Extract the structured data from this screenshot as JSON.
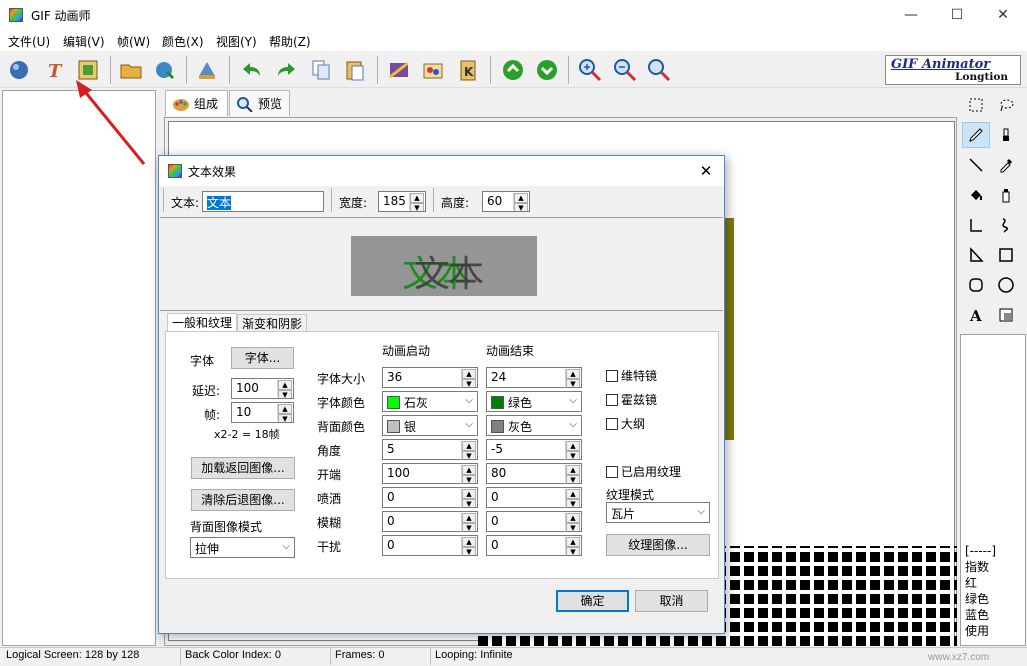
{
  "app": {
    "title": "GIF 动画师"
  },
  "window_controls": {
    "minimize": "—",
    "maximize": "☐",
    "close": "✕"
  },
  "menu": [
    "文件(U)",
    "编辑(V)",
    "帧(W)",
    "颜色(X)",
    "视图(Y)",
    "帮助(Z)"
  ],
  "toolbar": {
    "icons": [
      "globe-icon",
      "text-effect-icon",
      "image-frame-icon",
      "open-folder-icon",
      "load-icon",
      "wizard-icon",
      "undo-icon",
      "redo-icon",
      "copy-icon",
      "paste-icon",
      "frame-effect-icon",
      "stamp-icon",
      "clipboard-icon",
      "arrow-up-icon",
      "arrow-down-icon",
      "zoom-in-icon",
      "zoom-out-icon",
      "zoom-fit-icon"
    ]
  },
  "brand": {
    "title": "GIF Animator",
    "subtitle": "Longtion"
  },
  "main_tabs": [
    {
      "label": "组成"
    },
    {
      "label": "预览"
    }
  ],
  "right_tools": [
    "rect-select-icon",
    "lasso-icon",
    "pen-icon",
    "brush-icon",
    "line-icon",
    "eyedropper-icon",
    "fill-icon",
    "spray-icon",
    "polyline-icon",
    "curve-icon",
    "polygon-icon",
    "rectangle-icon",
    "rounded-rect-icon",
    "ellipse-icon",
    "text-tool-icon",
    "stamp-tool-icon"
  ],
  "info_panel": {
    "lines": [
      "[-----]",
      "指数",
      "红",
      "绿色",
      "蓝色",
      "使用"
    ]
  },
  "status": {
    "logical_screen": "Logical Screen: 128 by 128",
    "back_color": "Back Color Index: 0",
    "frames": "Frames: 0",
    "looping": "Looping: Infinite"
  },
  "watermark": "www.xz7.com",
  "dialog": {
    "title": "文本效果",
    "text_label": "文本:",
    "text_value": "文本",
    "width_label": "宽度:",
    "width_value": "185",
    "height_label": "高度:",
    "height_value": "60",
    "preview_text": "文本",
    "tabs": [
      "一般和纹理",
      "渐变和阴影"
    ],
    "font_label": "字体",
    "font_button": "字体...",
    "delay_label": "延迟:",
    "delay_value": "100",
    "frames_label": "帧:",
    "frames_value": "10",
    "frames_note": "x2-2 = 18帧",
    "load_back_button": "加载返回图像...",
    "clear_back_button": "清除后退图像...",
    "back_mode_label": "背面图像模式",
    "back_mode_value": "拉伸",
    "col_start": "动画启动",
    "col_end": "动画结束",
    "rows": [
      {
        "label": "字体大小",
        "start": "36",
        "end": "24",
        "kind": "spin"
      },
      {
        "label": "字体颜色",
        "start": "石灰",
        "end": "绿色",
        "kind": "color",
        "start_color": "#00ff00",
        "end_color": "#008000"
      },
      {
        "label": "背面颜色",
        "start": "银",
        "end": "灰色",
        "kind": "color",
        "start_color": "#c0c0c0",
        "end_color": "#808080"
      },
      {
        "label": "角度",
        "start": "5",
        "end": "-5",
        "kind": "spin"
      },
      {
        "label": "开端",
        "start": "100",
        "end": "80",
        "kind": "spin"
      },
      {
        "label": "喷洒",
        "start": "0",
        "end": "0",
        "kind": "spin"
      },
      {
        "label": "模糊",
        "start": "0",
        "end": "0",
        "kind": "spin"
      },
      {
        "label": "干扰",
        "start": "0",
        "end": "0",
        "kind": "spin"
      }
    ],
    "checkboxes": [
      "维特镜",
      "霍兹镜",
      "大纲"
    ],
    "texture_enabled": "已启用纹理",
    "texture_mode_label": "纹理模式",
    "texture_mode_value": "瓦片",
    "texture_button": "纹理图像...",
    "ok_button": "确定",
    "cancel_button": "取消"
  }
}
